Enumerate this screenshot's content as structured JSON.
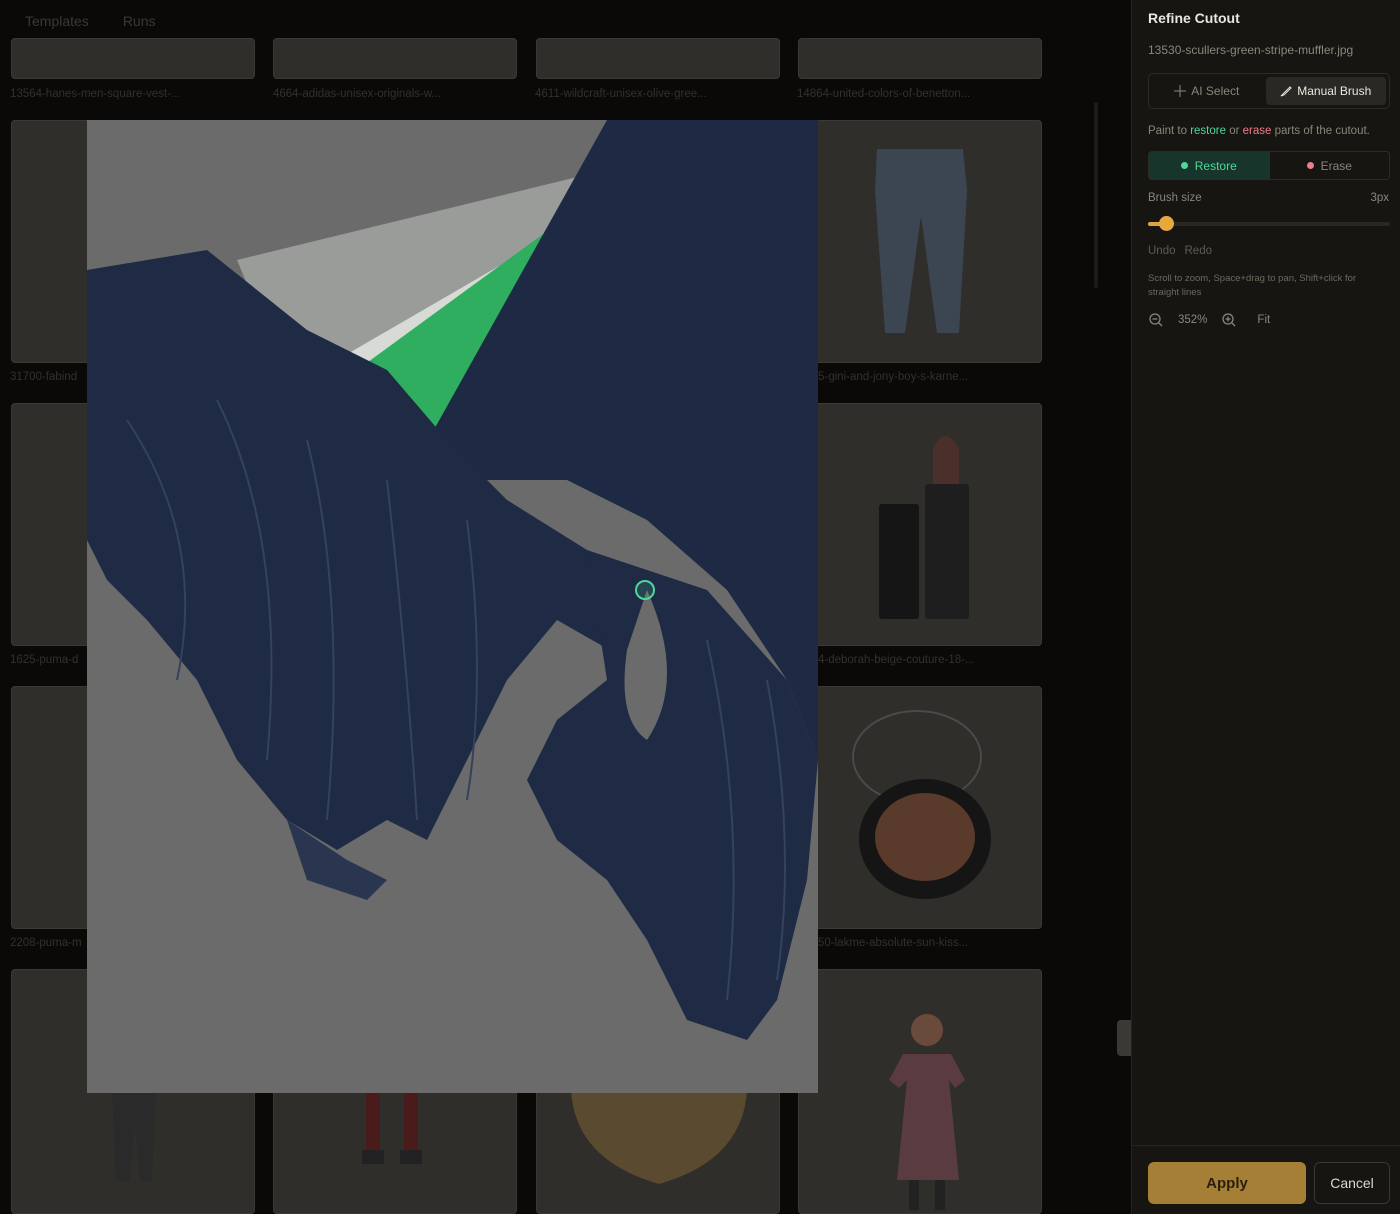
{
  "nav": {
    "templates": "Templates",
    "runs": "Runs"
  },
  "gallery": {
    "captions": [
      "13564-hanes-men-square-vest-...",
      "4664-adidas-unisex-originals-w...",
      "4611-wildcraft-unisex-olive-gree...",
      "14864-united-colors-of-benetton...",
      "31700-fabind",
      "5-gini-and-jony-boy-s-karne...",
      "1625-puma-d",
      "4-deborah-beige-couture-18-...",
      "2208-puma-m",
      "50-lakme-absolute-sun-kiss..."
    ]
  },
  "panel": {
    "title": "Refine Cutout",
    "filename": "13530-scullers-green-stripe-muffler.jpg",
    "modes": {
      "ai_select": "AI Select",
      "manual_brush": "Manual Brush",
      "active": "manual_brush"
    },
    "hint": {
      "prefix": "Paint to ",
      "restore": "restore",
      "middle": " or ",
      "erase": "erase",
      "suffix": " parts of the cutout."
    },
    "tools": {
      "restore": "Restore",
      "erase": "Erase",
      "active": "restore"
    },
    "brush": {
      "label": "Brush size",
      "value": "3px",
      "level_fraction": 0.05
    },
    "undo": "Undo",
    "redo": "Redo",
    "help": "Scroll to zoom, Space+drag to pan, Shift+click for straight lines",
    "zoom": {
      "value": "352%",
      "fit": "Fit"
    },
    "apply": "Apply",
    "cancel": "Cancel"
  },
  "colors": {
    "accent": "#d9a441",
    "restore": "#4fd79a",
    "erase": "#ef7d8a",
    "panel_bg": "#161512"
  }
}
